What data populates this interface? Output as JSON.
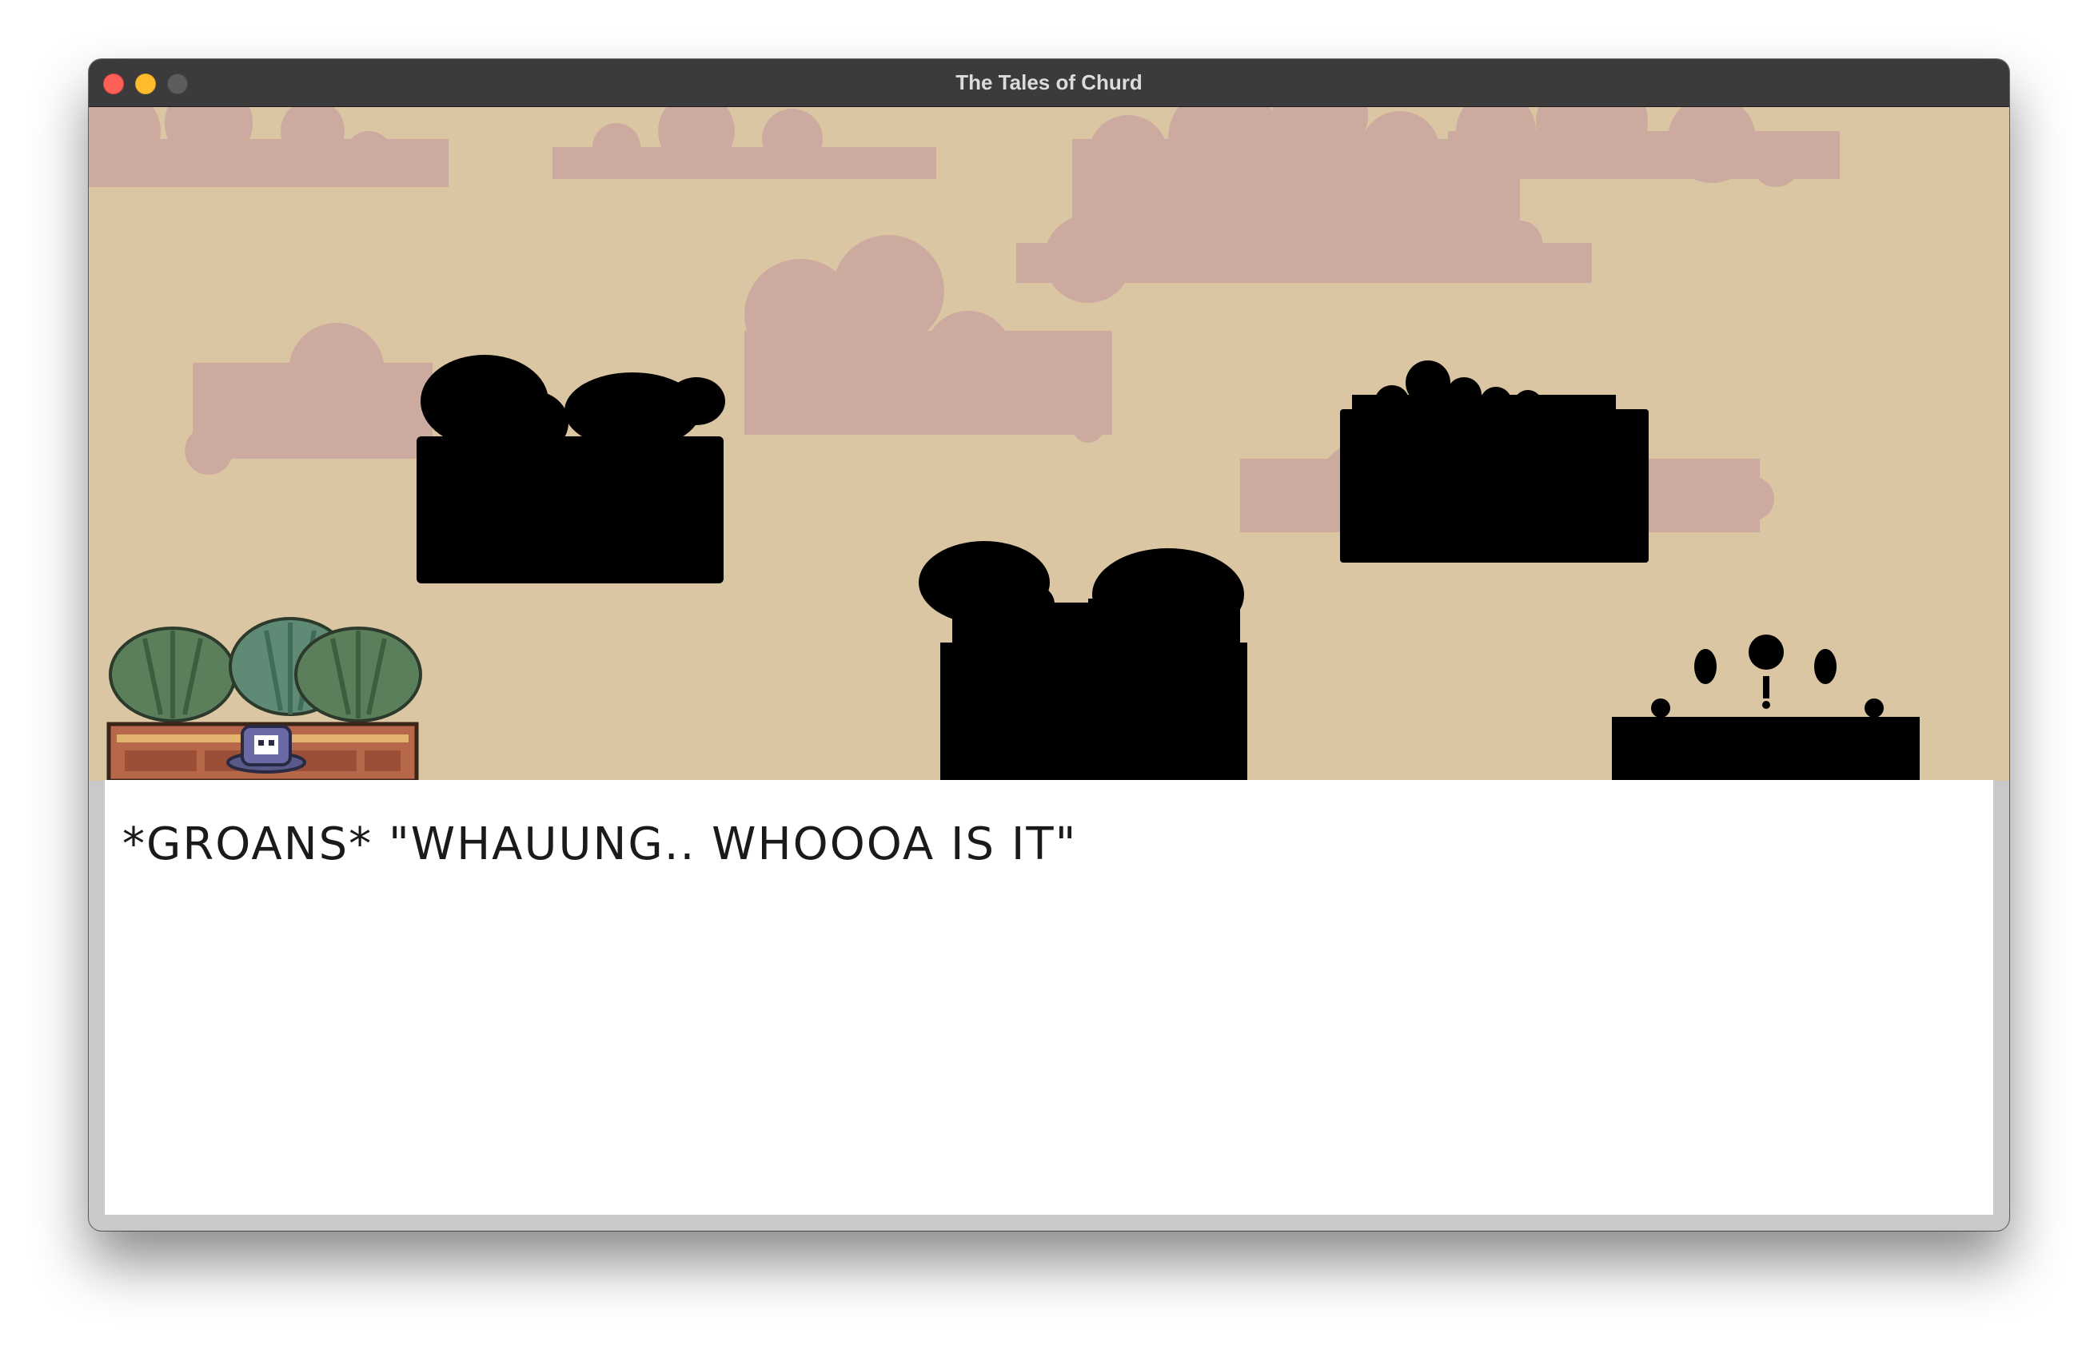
{
  "window": {
    "title": "The Tales of Churd",
    "buttons": [
      "close",
      "minimize",
      "zoom"
    ]
  },
  "scene": {
    "sky_color": "#dbc6a3",
    "cloud_color": "#cdaaa0",
    "silhouette_color": "#000000",
    "objects": [
      "cloud",
      "silhouette-bushes-block-1",
      "silhouette-bushes-block-2",
      "silhouette-bushes-block-3",
      "silhouette-exclamation-block",
      "palm-tree",
      "crate-with-skull"
    ]
  },
  "dialogue": {
    "text": "*GROANS* \"WHAUUNG.. WHOOOA IS IT\""
  },
  "colors": {
    "titlebar": "#3b3b3b",
    "close": "#fe5f57",
    "minimize": "#febc2e",
    "zoom": "#5d5d5d",
    "frame": "#c9c9c9",
    "dialogue_bg": "#ffffff"
  }
}
